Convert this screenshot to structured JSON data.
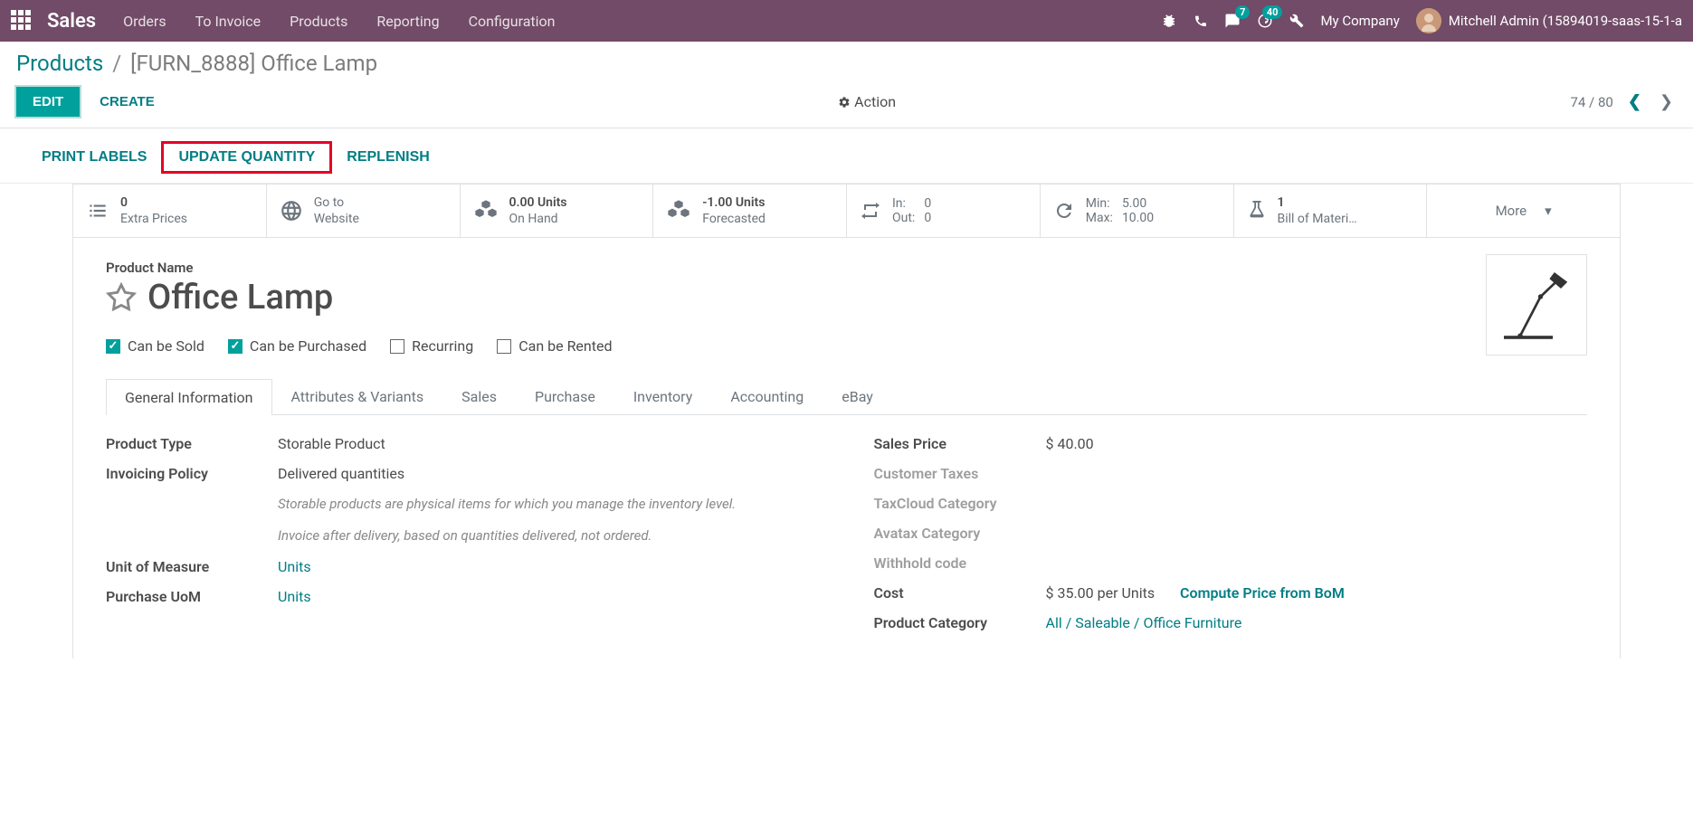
{
  "navbar": {
    "brand": "Sales",
    "menu": [
      "Orders",
      "To Invoice",
      "Products",
      "Reporting",
      "Configuration"
    ],
    "msg_badge": "7",
    "activity_badge": "40",
    "company": "My Company",
    "user": "Mitchell Admin (15894019-saas-15-1-a"
  },
  "breadcrumb": {
    "parent": "Products",
    "current": "[FURN_8888] Office Lamp"
  },
  "controls": {
    "edit": "EDIT",
    "create": "CREATE",
    "action": "Action",
    "pager": "74 / 80"
  },
  "secondary": {
    "print_labels": "PRINT LABELS",
    "update_qty": "UPDATE QUANTITY",
    "replenish": "REPLENISH"
  },
  "stats": {
    "extra_prices_val": "0",
    "extra_prices_lbl": "Extra Prices",
    "website_l1": "Go to",
    "website_l2": "Website",
    "onhand_val": "0.00 Units",
    "onhand_lbl": "On Hand",
    "forecast_val": "-1.00 Units",
    "forecast_lbl": "Forecasted",
    "in_lbl": "In:",
    "in_val": "0",
    "out_lbl": "Out:",
    "out_val": "0",
    "min_lbl": "Min:",
    "min_val": "5.00",
    "max_lbl": "Max:",
    "max_val": "10.00",
    "bom_val": "1",
    "bom_lbl": "Bill of Materi…",
    "more": "More"
  },
  "form": {
    "name_label": "Product Name",
    "name": "Office Lamp",
    "can_sold": "Can be Sold",
    "can_purchased": "Can be Purchased",
    "recurring": "Recurring",
    "can_rented": "Can be Rented"
  },
  "tabs": [
    "General Information",
    "Attributes & Variants",
    "Sales",
    "Purchase",
    "Inventory",
    "Accounting",
    "eBay"
  ],
  "left_fields": {
    "product_type_lbl": "Product Type",
    "product_type_val": "Storable Product",
    "invoicing_lbl": "Invoicing Policy",
    "invoicing_val": "Delivered quantities",
    "help1": "Storable products are physical items for which you manage the inventory level.",
    "help2": "Invoice after delivery, based on quantities delivered, not ordered.",
    "uom_lbl": "Unit of Measure",
    "uom_val": "Units",
    "purchase_uom_lbl": "Purchase UoM",
    "purchase_uom_val": "Units"
  },
  "right_fields": {
    "sales_price_lbl": "Sales Price",
    "sales_price_val": "$ 40.00",
    "customer_taxes_lbl": "Customer Taxes",
    "taxcloud_lbl": "TaxCloud Category",
    "avatax_lbl": "Avatax Category",
    "withhold_lbl": "Withhold code",
    "cost_lbl": "Cost",
    "cost_val": "$ 35.00 per Units",
    "compute_link": "Compute Price from BoM",
    "category_lbl": "Product Category",
    "category_val": "All / Saleable / Office Furniture"
  }
}
